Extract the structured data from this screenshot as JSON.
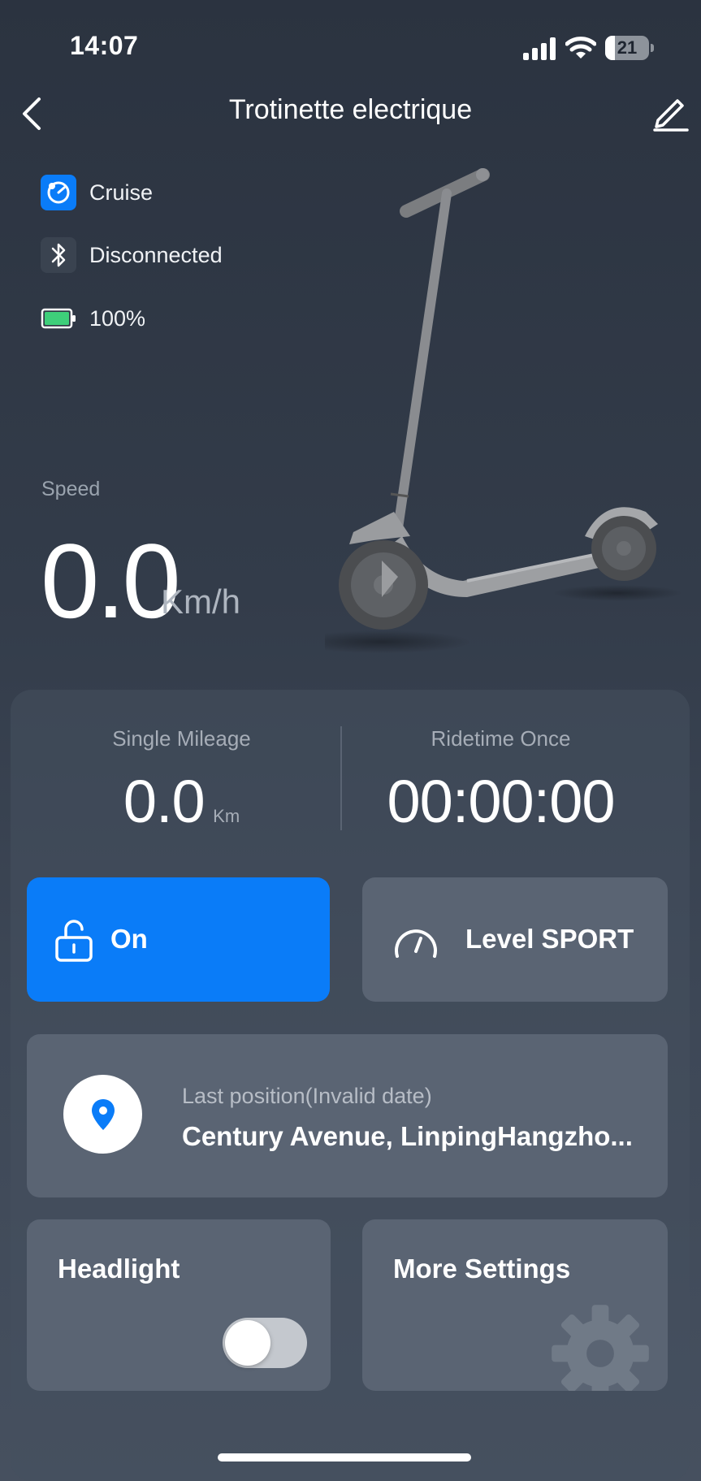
{
  "status_bar": {
    "time": "14:07",
    "battery_level": "21"
  },
  "nav": {
    "title": "Trotinette electrique"
  },
  "info": {
    "mode": "Cruise",
    "connection": "Disconnected",
    "battery": "100%"
  },
  "speed": {
    "label": "Speed",
    "value": "0.0",
    "unit": "Km/h"
  },
  "stats": {
    "mileage_label": "Single Mileage",
    "mileage_value": "0.0",
    "mileage_unit": "Km",
    "ridetime_label": "Ridetime Once",
    "ridetime_value": "00:00:00"
  },
  "controls": {
    "lock_label": "On",
    "level_label": "Level SPORT"
  },
  "position": {
    "label": "Last position(Invalid date)",
    "address": "Century Avenue, LinpingHangzho..."
  },
  "headlight": {
    "label": "Headlight",
    "state": "off"
  },
  "more": {
    "label": "More Settings"
  },
  "colors": {
    "accent": "#0a7cf8",
    "battery_green": "#3ecf7a"
  }
}
